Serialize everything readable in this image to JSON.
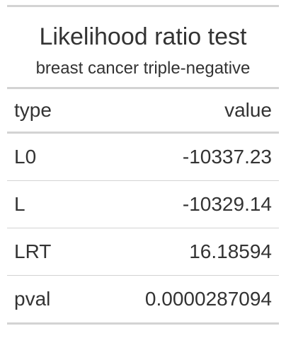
{
  "table": {
    "title": "Likelihood ratio test",
    "subtitle": "breast cancer triple-negative",
    "columns": [
      "type",
      "value"
    ],
    "rows": [
      {
        "type": "L0",
        "value": "-10337.23"
      },
      {
        "type": "L",
        "value": "-10329.14"
      },
      {
        "type": "LRT",
        "value": "16.18594"
      },
      {
        "type": "pval",
        "value": "0.0000287094"
      }
    ]
  },
  "colors": {
    "text": "#333333",
    "rule": "#d3d3d3",
    "background": "#ffffff"
  }
}
